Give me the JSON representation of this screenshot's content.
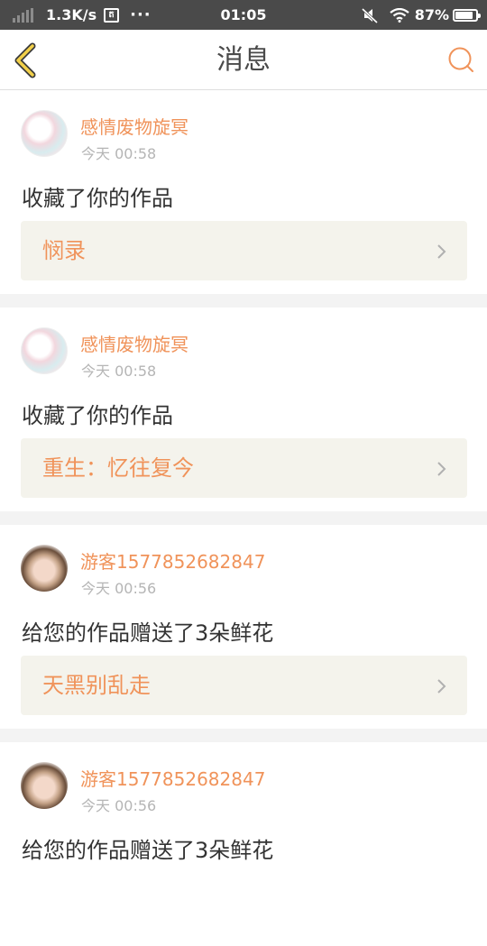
{
  "status_bar": {
    "speed": "1.3K/s",
    "net_icon_glyph": "ត",
    "more": "···",
    "time": "01:05",
    "battery": "87%",
    "battery_level": 0.87
  },
  "header": {
    "title": "消息",
    "back_icon": "chevron-left-icon",
    "search_icon": "search-icon",
    "accent_color": "#f0935a"
  },
  "messages": [
    {
      "username": "感情废物旋冥",
      "time": "今天 00:58",
      "text": "收藏了你的作品",
      "work": "悯录",
      "avatar_style": "anime"
    },
    {
      "username": "感情废物旋冥",
      "time": "今天 00:58",
      "text": "收藏了你的作品",
      "work": "重生：忆往复今",
      "avatar_style": "anime"
    },
    {
      "username": "游客1577852682847",
      "time": "今天 00:56",
      "text": "给您的作品赠送了3朵鲜花",
      "work": "天黑别乱走",
      "avatar_style": "photo"
    },
    {
      "username": "游客1577852682847",
      "time": "今天 00:56",
      "text": "给您的作品赠送了3朵鲜花",
      "avatar_style": "photo"
    }
  ]
}
